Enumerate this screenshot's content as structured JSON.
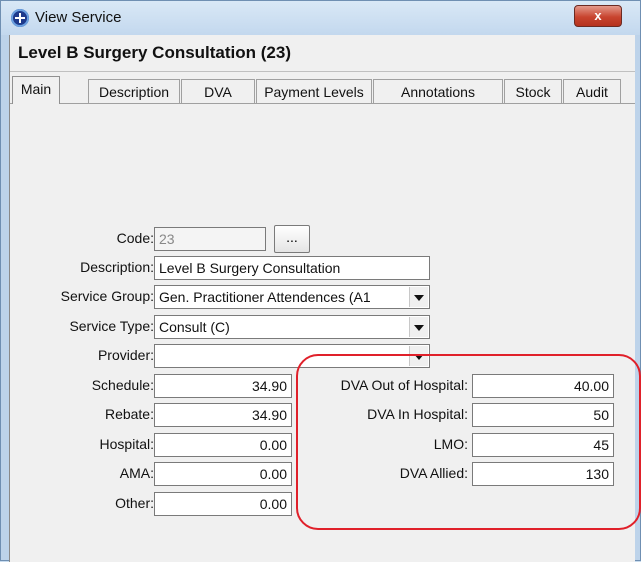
{
  "window": {
    "title": "View Service",
    "close_label": "x"
  },
  "header": {
    "title": "Level B Surgery Consultation (23)"
  },
  "tabs": [
    "Main",
    "Description",
    "DVA",
    "Payment Levels",
    "Annotations",
    "Stock",
    "Audit"
  ],
  "form": {
    "code": {
      "label": "Code:",
      "value": "23",
      "browse_label": "..."
    },
    "description": {
      "label": "Description:",
      "value": "Level B Surgery Consultation"
    },
    "service_group": {
      "label": "Service Group:",
      "value": "Gen. Practitioner Attendences (A1"
    },
    "service_type": {
      "label": "Service Type:",
      "value": "Consult (C)"
    },
    "provider": {
      "label": "Provider:",
      "value": ""
    },
    "schedule": {
      "label": "Schedule:",
      "value": "34.90"
    },
    "rebate": {
      "label": "Rebate:",
      "value": "34.90"
    },
    "hospital": {
      "label": "Hospital:",
      "value": "0.00"
    },
    "ama": {
      "label": "AMA:",
      "value": "0.00"
    },
    "other": {
      "label": "Other:",
      "value": "0.00"
    }
  },
  "dva": {
    "out_of_hospital": {
      "label": "DVA Out of Hospital:",
      "value": "40.00"
    },
    "in_hospital": {
      "label": "DVA In Hospital:",
      "value": "50"
    },
    "lmo": {
      "label": "LMO:",
      "value": "45"
    },
    "allied": {
      "label": "DVA Allied:",
      "value": "130"
    }
  },
  "colors": {
    "highlight": "#e0202a",
    "close_button": "#c8442f"
  }
}
